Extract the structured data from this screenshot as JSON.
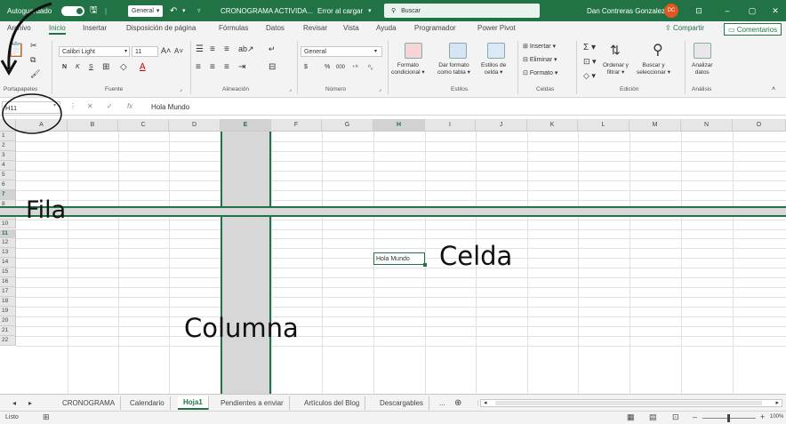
{
  "titlebar": {
    "autosave_label": "Autoguardado",
    "font_select": "General",
    "doc_title": "CRONOGRAMA ACTIVIDA...",
    "load_status": "Error al cargar",
    "search_placeholder": "Buscar",
    "user_name": "Dan Contreras Gonzalez",
    "user_initials": "DC"
  },
  "menu": {
    "tabs": [
      "Archivo",
      "Inicio",
      "Insertar",
      "Disposición de página",
      "Fórmulas",
      "Datos",
      "Revisar",
      "Vista",
      "Ayuda",
      "Programador",
      "Power Pivot"
    ],
    "active_tab": "Inicio",
    "share_label": "Compartir",
    "comments_label": "Comentarios"
  },
  "ribbon": {
    "groups": {
      "clipboard": "Portapapeles",
      "font": "Fuente",
      "alignment": "Alineación",
      "number": "Número",
      "styles": "Estilos",
      "cells": "Celdas",
      "editing": "Edición",
      "analysis": "Análisis"
    },
    "font_name": "Calibri Light",
    "font_size": "11",
    "number_format": "General",
    "bold": "N",
    "italic": "K",
    "underline": "S",
    "currency": "$",
    "percent": "%",
    "thousands": "000",
    "conditional_format": [
      "Formato",
      "condicional"
    ],
    "format_as_table": [
      "Dar formato",
      "como tabla"
    ],
    "cell_styles": [
      "Estilos de",
      "celda"
    ],
    "insert": "Insertar",
    "delete": "Eliminar",
    "format": "Formato",
    "sort_filter": [
      "Ordenar y",
      "filtrar"
    ],
    "find_select": [
      "Buscar y",
      "seleccionar"
    ],
    "analyze": [
      "Analizar",
      "datos"
    ]
  },
  "formula_bar": {
    "name_box": "H11",
    "fx": "fx",
    "value": "Hola Mundo"
  },
  "grid": {
    "columns": [
      "A",
      "B",
      "C",
      "D",
      "E",
      "F",
      "G",
      "H",
      "I",
      "J",
      "K",
      "L",
      "M",
      "N",
      "O"
    ],
    "rows": [
      "1",
      "2",
      "3",
      "4",
      "5",
      "6",
      "7",
      "8",
      "9",
      "10",
      "11",
      "12",
      "13",
      "14",
      "15",
      "16",
      "17",
      "18",
      "19",
      "20",
      "21",
      "22"
    ],
    "active_cell_value": "Hola Mundo"
  },
  "annotations": {
    "row": "Fila",
    "cell": "Celda",
    "column": "Columna"
  },
  "sheets": {
    "tabs": [
      "CRONOGRAMA",
      "Calendario",
      "Hoja1",
      "Pendientes a enviar",
      "Artículos del Blog",
      "Descargables"
    ],
    "active": "Hoja1",
    "more": "...",
    "add": "⊕"
  },
  "statusbar": {
    "ready": "Listo",
    "zoom": "100%"
  }
}
